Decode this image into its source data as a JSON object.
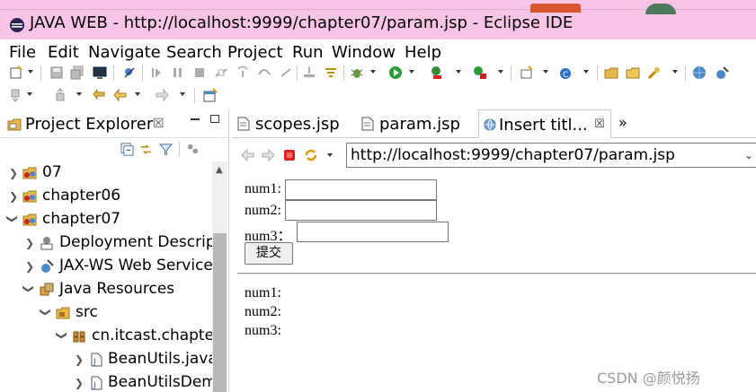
{
  "window": {
    "title": "JAVA WEB - http://localhost:9999/chapter07/param.jsp - Eclipse IDE"
  },
  "menu": [
    "File",
    "Edit",
    "Navigate",
    "Search",
    "Project",
    "Run",
    "Window",
    "Help"
  ],
  "project_explorer": {
    "title": "Project Explorer",
    "close_glyph": "☒",
    "tree": [
      {
        "label": "07",
        "expanded": false,
        "icon": "project-icon"
      },
      {
        "label": "chapter06",
        "expanded": false,
        "icon": "project-icon"
      },
      {
        "label": "chapter07",
        "expanded": true,
        "icon": "project-icon"
      },
      {
        "label": "Deployment Descrip",
        "expanded": false,
        "icon": "deployment-descriptor-icon"
      },
      {
        "label": "JAX-WS Web Service",
        "expanded": false,
        "icon": "web-service-icon"
      },
      {
        "label": "Java Resources",
        "expanded": true,
        "icon": "java-resources-icon"
      },
      {
        "label": "src",
        "expanded": true,
        "icon": "source-folder-icon"
      },
      {
        "label": "cn.itcast.chapter",
        "expanded": true,
        "icon": "package-icon"
      },
      {
        "label": "BeanUtils.java",
        "expanded": false,
        "icon": "java-file-icon"
      },
      {
        "label": "BeanUtilsDem",
        "expanded": false,
        "icon": "java-file-icon"
      }
    ]
  },
  "editor": {
    "tabs": [
      {
        "label": "scopes.jsp",
        "icon": "jsp-file-icon",
        "active": false
      },
      {
        "label": "param.jsp",
        "icon": "jsp-file-icon",
        "active": false
      },
      {
        "label": "Insert titl...",
        "icon": "globe-icon",
        "active": true
      }
    ],
    "tab_close_glyph": "☒",
    "overflow_label": "»",
    "url": "http://localhost:9999/chapter07/param.jsp"
  },
  "page": {
    "form": {
      "fields": [
        {
          "label": "num1:",
          "value": ""
        },
        {
          "label": "num2:",
          "value": ""
        },
        {
          "label": "num3：",
          "value": ""
        }
      ],
      "submit_label": "提交"
    },
    "results": [
      "num1:",
      "num2:",
      "num3:"
    ]
  },
  "watermark": "CSDN @颜悦扬",
  "colors": {
    "title_bar": "#f7c4e6",
    "stop": "#d9251d",
    "run": "#2e9c3b"
  }
}
